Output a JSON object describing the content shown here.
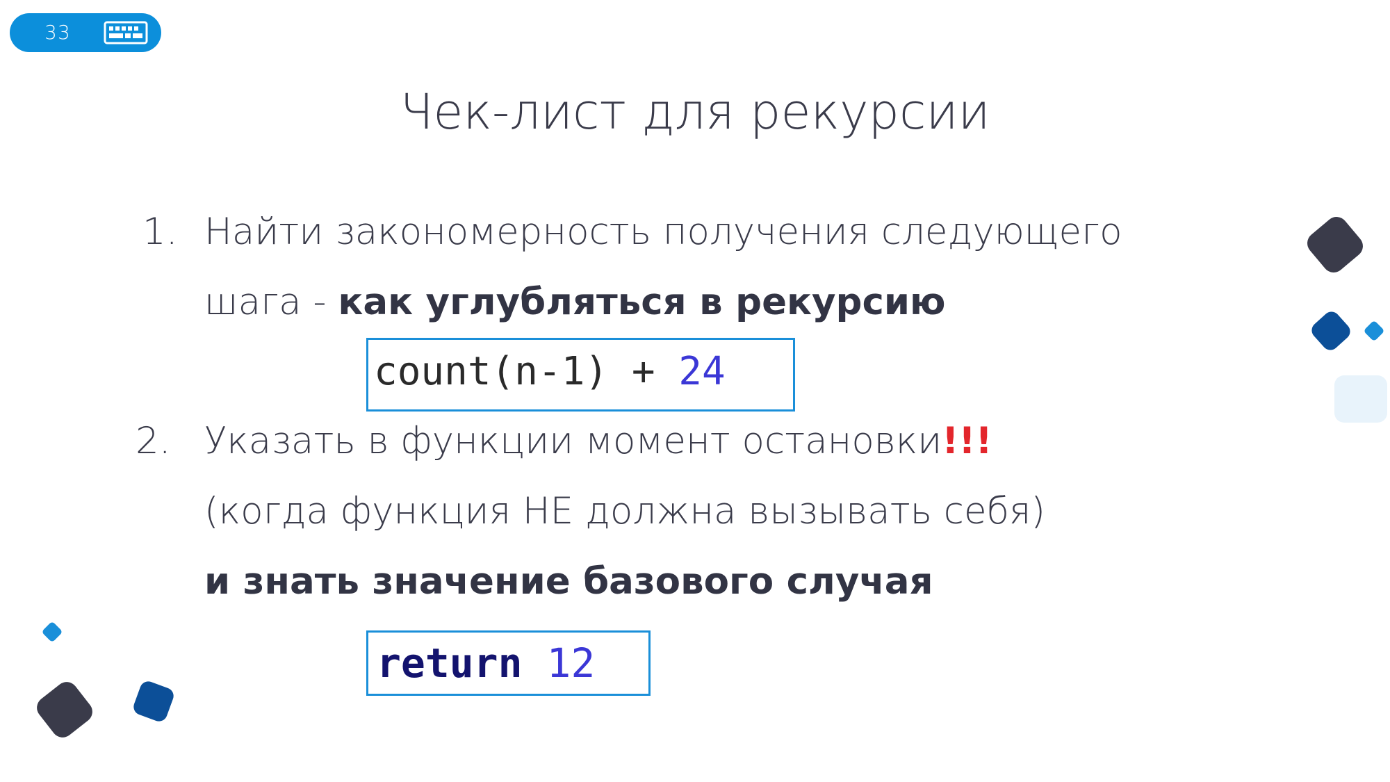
{
  "badge": {
    "page_number": "33",
    "icon": "keyboard-icon",
    "color": "#0c8fdb"
  },
  "title": "Чек-лист для рекурсии",
  "items": [
    {
      "number": "1.",
      "line1": "Найти закономерность получения следующего",
      "line2_plain": "шага - ",
      "line2_bold": "как углубляться в рекурсию",
      "code": {
        "text": "count(n-1) + ",
        "number": "24"
      }
    },
    {
      "number": "2.",
      "line1": "Указать в функции момент остановки",
      "line1_emphasis": "!!!",
      "line2": "(когда функция НЕ должна вызывать себя)",
      "line3_bold": "и знать значение базового случая",
      "code": {
        "keyword": "return",
        "number": "12"
      }
    }
  ],
  "colors": {
    "dark_square": "#3a3b4a",
    "blue_square": "#0c4f98",
    "light_blue_square": "#1a8fd9",
    "pale_square": "#e8f3fb",
    "code_border": "#1a8fd9",
    "emphasis": "#e3262c"
  }
}
